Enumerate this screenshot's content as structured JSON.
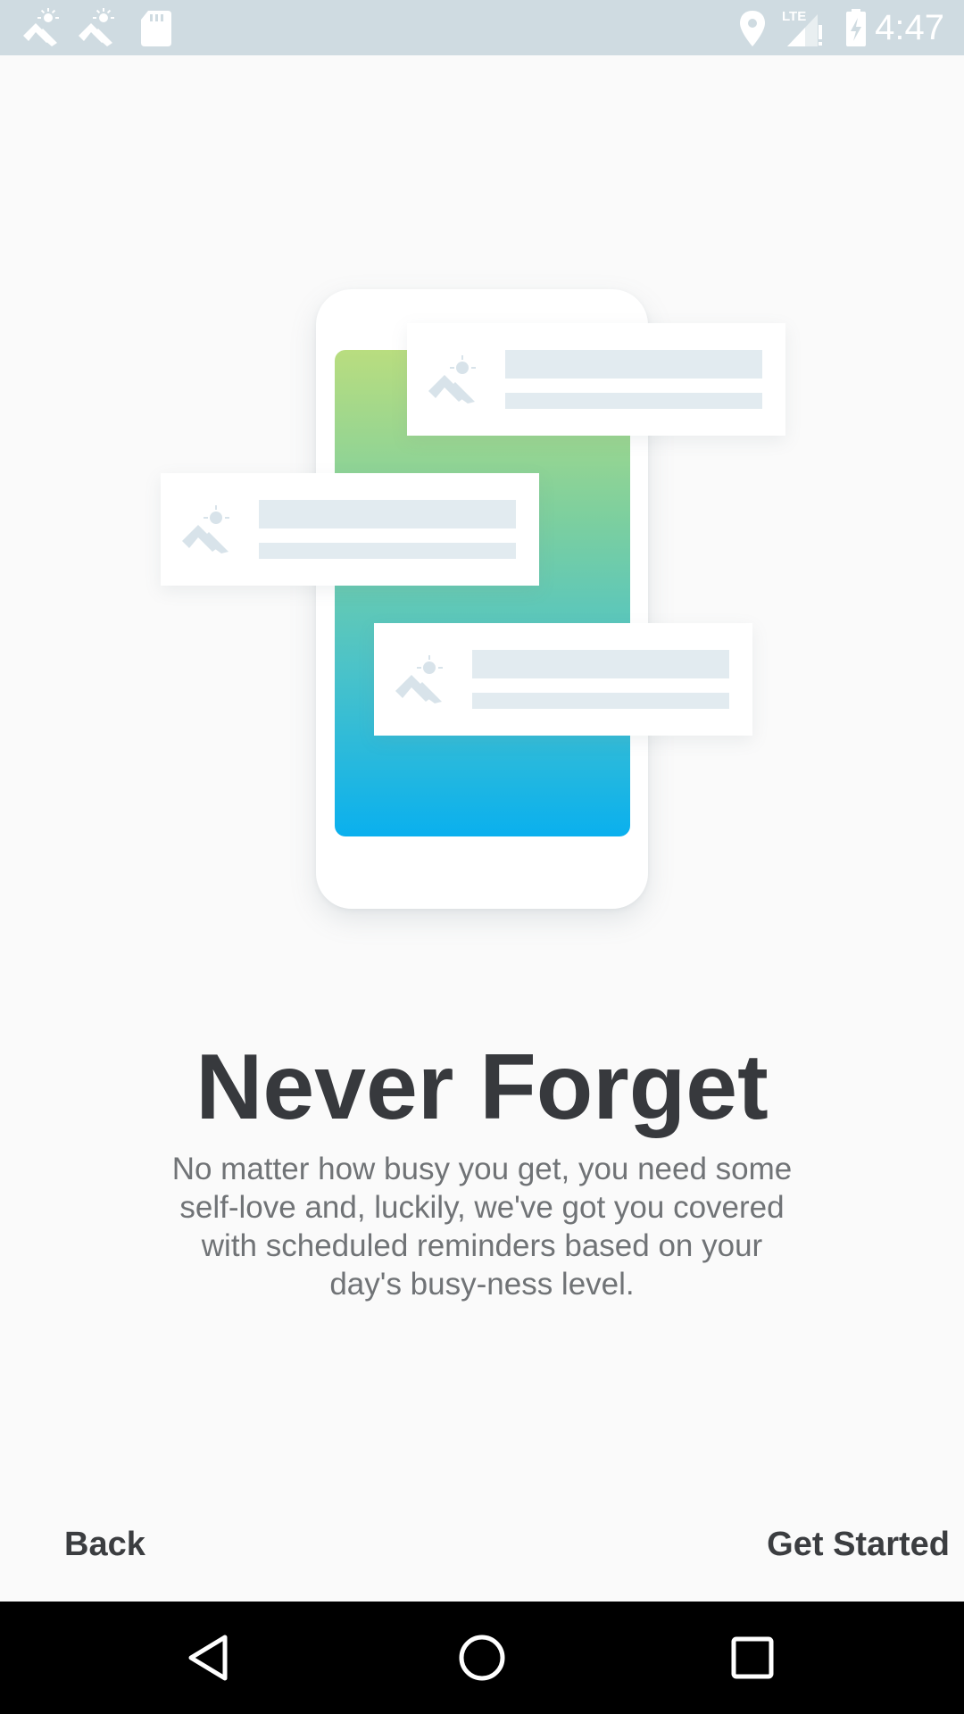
{
  "status_bar": {
    "time": "4:47",
    "left_icons": [
      "app-notification-icon",
      "app-notification-icon",
      "sd-card-icon"
    ],
    "right_icons": [
      "location-icon",
      "lte-signal-icon",
      "battery-charging-icon"
    ],
    "lte_label": "LTE",
    "background": "#cfdbe1"
  },
  "onboarding": {
    "title": "Never Forget",
    "description": "No matter how busy you get, you need some self-love and, luckily, we've got you covered with scheduled reminders based on your day's busy-ness level.",
    "illustration": {
      "phone_gradient": [
        "#b9dd7f",
        "#0ab0ee"
      ],
      "notification_count": 3,
      "notification_icon": "app-logo-icon"
    }
  },
  "actions": {
    "back_label": "Back",
    "get_started_label": "Get Started"
  },
  "nav_bar": {
    "buttons": [
      "back-triangle-icon",
      "home-circle-icon",
      "recents-square-icon"
    ]
  }
}
